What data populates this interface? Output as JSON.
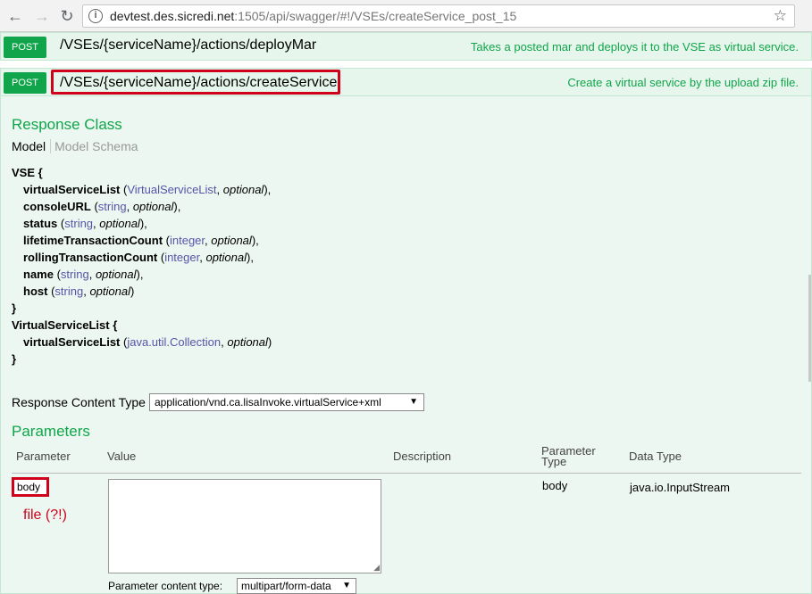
{
  "browser": {
    "url_host": "devtest.des.sicredi.net",
    "url_rest": ":1505/api/swagger/#!/VSEs/createService_post_15",
    "icons": [
      "back-icon",
      "forward-icon",
      "reload-icon",
      "info-icon",
      "star-icon"
    ]
  },
  "operations": [
    {
      "method": "POST",
      "path": "/VSEs/{serviceName}/actions/deployMar",
      "description": "Takes a posted mar and deploys it to the VSE as virtual service."
    },
    {
      "method": "POST",
      "path": "/VSEs/{serviceName}/actions/createService",
      "description": "Create a virtual service by the upload zip file."
    }
  ],
  "response_class": {
    "heading": "Response Class",
    "tab_model": "Model",
    "tab_schema": "Model Schema"
  },
  "schema": {
    "vse_open": "VSE {",
    "vse_props": [
      {
        "name": "virtualServiceList",
        "type": "VirtualServiceList",
        "opt": "optional",
        "end": "),"
      },
      {
        "name": "consoleURL",
        "type": "string",
        "opt": "optional",
        "end": "),"
      },
      {
        "name": "status",
        "type": "string",
        "opt": "optional",
        "end": "),"
      },
      {
        "name": "lifetimeTransactionCount",
        "type": "integer",
        "opt": "optional",
        "end": "),"
      },
      {
        "name": "rollingTransactionCount",
        "type": "integer",
        "opt": "optional",
        "end": "),"
      },
      {
        "name": "name",
        "type": "string",
        "opt": "optional",
        "end": "),"
      },
      {
        "name": "host",
        "type": "string",
        "opt": "optional",
        "end": ")"
      }
    ],
    "close": "}",
    "vsl_open": "VirtualServiceList {",
    "vsl_props": [
      {
        "name": "virtualServiceList",
        "type": "java.util.Collection",
        "opt": "optional",
        "end": ")"
      }
    ]
  },
  "response_content_type": {
    "label": "Response Content Type",
    "value": "application/vnd.ca.lisaInvoke.virtualService+xml"
  },
  "parameters": {
    "heading": "Parameters",
    "columns": {
      "parameter": "Parameter",
      "value": "Value",
      "description": "Description",
      "param_type_1": "Parameter",
      "param_type_2": "Type",
      "data_type": "Data Type"
    },
    "row": {
      "name": "body",
      "note": "file (?!)",
      "param_type": "body",
      "data_type": "java.io.InputStream",
      "content_type_label": "Parameter content type:",
      "content_type_value": "multipart/form-data"
    }
  }
}
